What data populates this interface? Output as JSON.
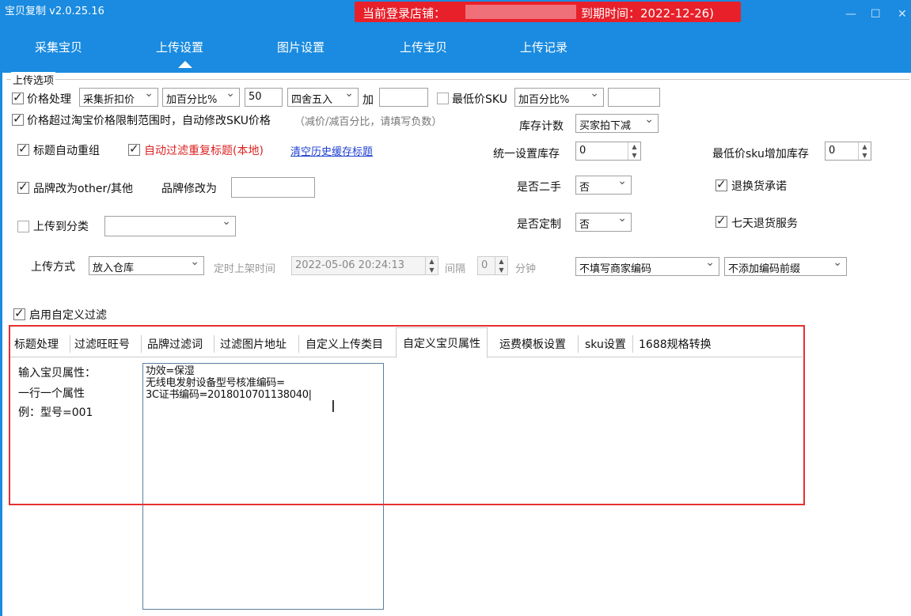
{
  "app": {
    "title": "宝贝复制 v2.0.25.16"
  },
  "banner": {
    "login_label": "当前登录店铺：",
    "expire": "到期时间：2022-12-26)"
  },
  "window": {
    "minimize": "—",
    "maximize": "☐",
    "close": "✕"
  },
  "nav": [
    "采集宝贝",
    "上传设置",
    "图片设置",
    "上传宝贝",
    "上传记录"
  ],
  "group": {
    "title": "上传选项"
  },
  "row1": {
    "price_label": "价格处理",
    "price_source": "采集折扣价",
    "price_mode": "加百分比%",
    "price_value": "50",
    "rounding": "四舍五入",
    "add_label": "加",
    "add_value": "",
    "min_sku_label": "最低价SKU",
    "min_sku_mode": "加百分比%",
    "min_sku_value": ""
  },
  "row2": {
    "label": "价格超过淘宝价格限制范围时，自动修改SKU价格",
    "hint": "（减价/减百分比，请填写负数）",
    "stock_label": "库存计数",
    "stock_value": "买家拍下减"
  },
  "row3": {
    "title_regroup": "标题自动重组",
    "auto_filter": "自动过滤重复标题(本地)",
    "clear_link": "清空历史缓存标题",
    "uniform_stock_label": "统一设置库存",
    "uniform_stock_value": "0",
    "minsku_add_label": "最低价sku增加库存",
    "minsku_add_value": "0"
  },
  "row4": {
    "brand_other": "品牌改为other/其他",
    "brand_modify_label": "品牌修改为",
    "brand_modify_value": "",
    "secondhand_label": "是否二手",
    "secondhand_value": "否",
    "return_promise": "退换货承诺"
  },
  "row5": {
    "upload_cat": "上传到分类",
    "upload_cat_value": "",
    "custom_label": "是否定制",
    "custom_value": "否",
    "seven_day": "七天退货服务"
  },
  "row6": {
    "method_label": "上传方式",
    "method_value": "放入仓库",
    "timed_label": "定时上架时间",
    "timed_value": "2022-05-06 20:24:13",
    "interval_label": "间隔",
    "interval_value": "0",
    "minute_label": "分钟",
    "merchant_code": "不填写商家编码",
    "code_prefix": "不添加编码前缀"
  },
  "custom_filter": {
    "label": "启用自定义过滤"
  },
  "tabs": [
    "标题处理",
    "过滤旺旺号",
    "品牌过滤词",
    "过滤图片地址",
    "自定义上传类目",
    "自定义宝贝属性",
    "运费模板设置",
    "sku设置",
    "1688规格转换"
  ],
  "attr_panel": {
    "line1": "输入宝贝属性：",
    "line2": "一行一个属性",
    "line3": "例：型号=001",
    "text_lines": [
      "功效=保湿",
      "无线电发射设备型号核准编码=",
      "3C证书编码=2018010701138040|"
    ]
  }
}
